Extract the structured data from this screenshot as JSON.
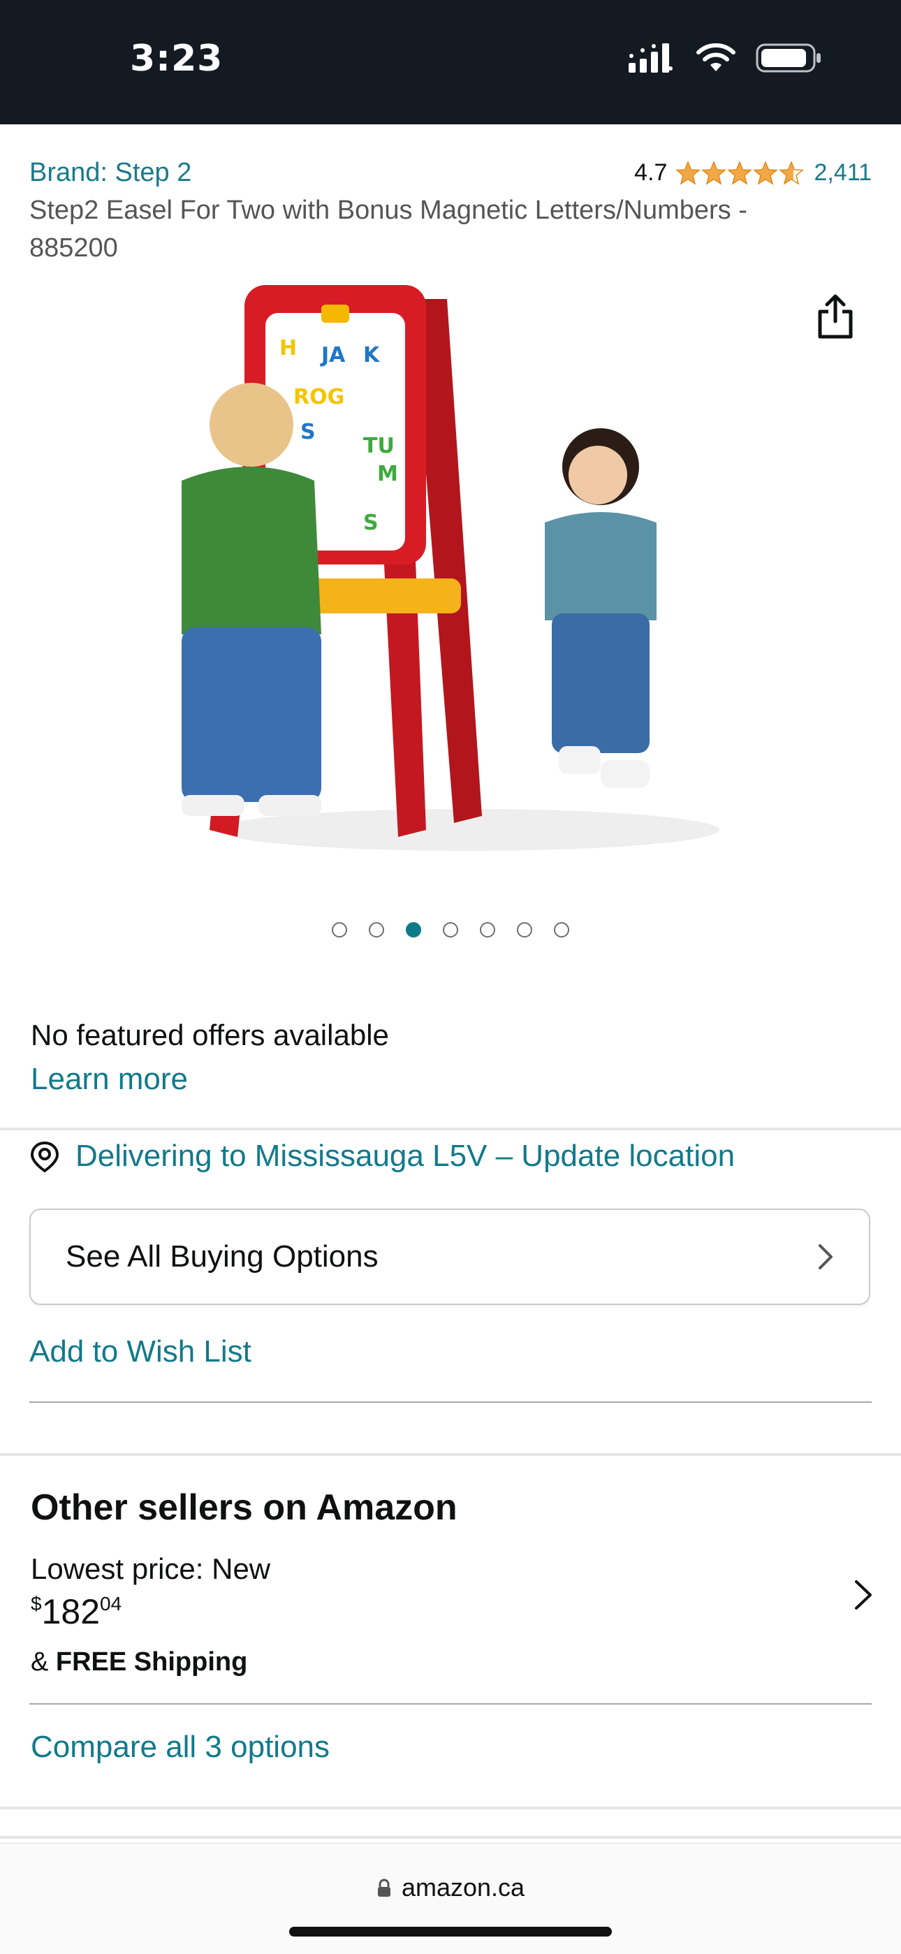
{
  "status_bar": {
    "time": "3:23"
  },
  "product": {
    "brand_label": "Brand: Step 2",
    "rating_value": "4.7",
    "rating_count": "2,411",
    "title": "Step2 Easel For Two with Bonus Magnetic Letters/Numbers - 885200",
    "image_alt": "Step2 easel with two children",
    "carousel": {
      "total": 7,
      "active_index": 2
    }
  },
  "offers": {
    "no_offers_text": "No featured offers available",
    "learn_more": "Learn more"
  },
  "delivery": {
    "location_text": "Delivering to Mississauga L5V – Update location"
  },
  "buying_options": {
    "label": "See All Buying Options"
  },
  "wishlist": {
    "label": "Add to Wish List"
  },
  "other_sellers": {
    "title": "Other sellers on Amazon",
    "lowest_price_label": "Lowest price: New",
    "price_currency": "$",
    "price_whole": "182",
    "price_fraction": "04",
    "shipping_prefix": "& ",
    "shipping_label": "FREE Shipping",
    "compare_label": "Compare all 3 options"
  },
  "browser": {
    "url": "amazon.ca"
  },
  "colors": {
    "link": "#117a8b",
    "star": "#f3a847",
    "status_bar": "#141a22"
  }
}
